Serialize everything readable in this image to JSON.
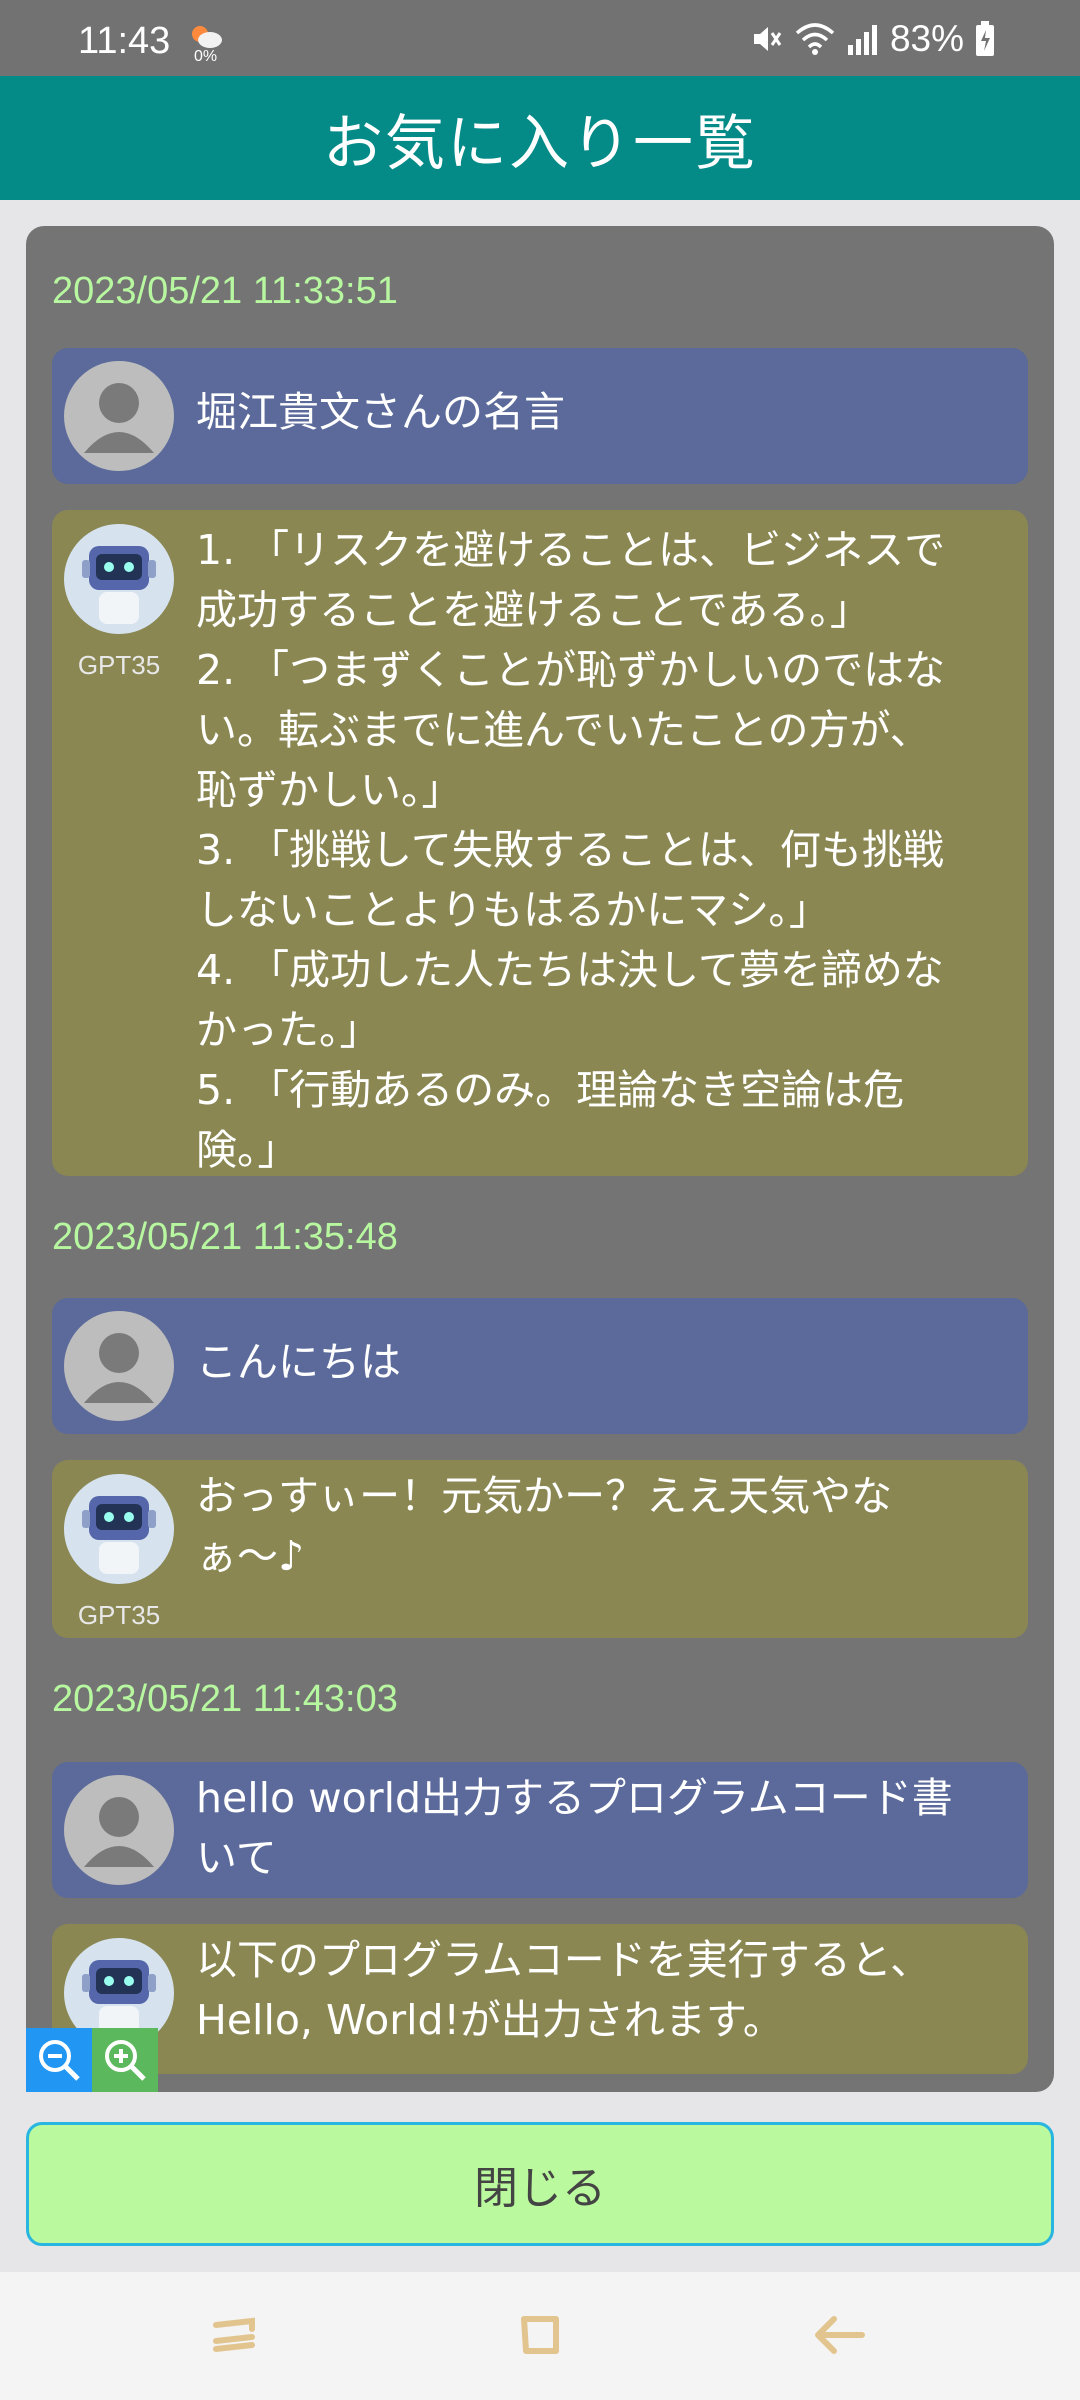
{
  "status_bar": {
    "time": "11:43",
    "weather_percent": "0%",
    "battery": "83%",
    "icons": [
      "weather-icon",
      "mute-icon",
      "wifi-icon",
      "signal-icon",
      "battery-icon"
    ]
  },
  "header": {
    "title": "お気に入り一覧",
    "color": "#048b88"
  },
  "favorites": [
    {
      "timestamp": "2023/05/21 11:33:51",
      "user_message": "堀江貴文さんの名言",
      "bot_name": "GPT35",
      "bot_lines": [
        "1. 「リスクを避けることは、ビジネスで",
        "成功することを避けることである。」",
        "2. 「つまずくことが恥ずかしいのではな",
        "い。転ぶまでに進んでいたことの方が、",
        "恥ずかしい。」",
        "3. 「挑戦して失敗することは、何も挑戦",
        "しないことよりもはるかにマシ。」",
        "4. 「成功した人たちは決して夢を諦めな",
        "かった。」",
        "5. 「行動あるのみ。理論なき空論は危",
        "険。」"
      ]
    },
    {
      "timestamp": "2023/05/21 11:35:48",
      "user_message": "こんにちは",
      "bot_name": "GPT35",
      "bot_lines": [
        "おっすぃー！元気かー？ええ天気やな",
        "ぁ〜♪"
      ]
    },
    {
      "timestamp": "2023/05/21 11:43:03",
      "user_lines": [
        "hello world出力するプログラムコード書",
        "いて"
      ],
      "bot_lines": [
        "以下のプログラムコードを実行すると、",
        "Hello, World!が出力されます。"
      ]
    }
  ],
  "zoom": {
    "out_icon": "zoom-out-icon",
    "in_icon": "zoom-in-icon"
  },
  "close_button": {
    "label": "閉じる",
    "color": "#baf99d"
  },
  "navigation": {
    "items": [
      "recents-icon",
      "home-icon",
      "back-icon"
    ]
  }
}
